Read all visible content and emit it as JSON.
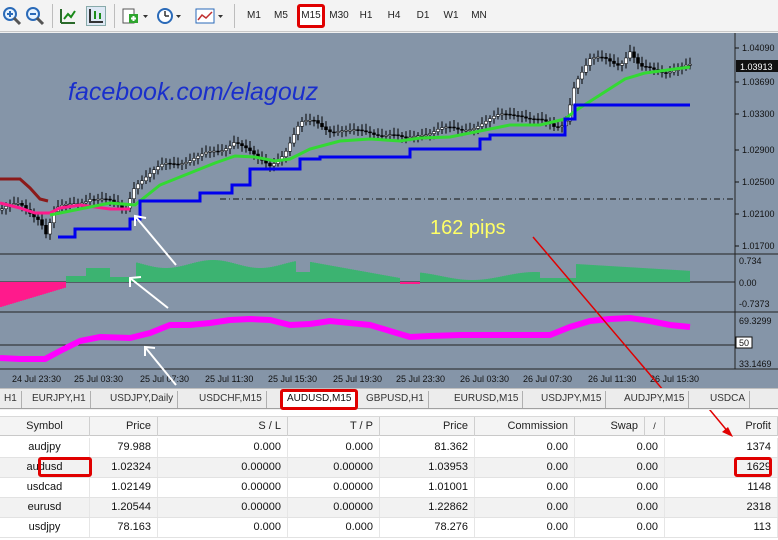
{
  "toolbar": {
    "icons": [
      "zoom-in-icon",
      "zoom-out-icon",
      "chart-type-icon",
      "crosshair-icon",
      "new-order-icon",
      "clock-icon",
      "templates-icon"
    ],
    "timeframes": [
      "M1",
      "M5",
      "M15",
      "M30",
      "H1",
      "H4",
      "D1",
      "W1",
      "MN"
    ],
    "selected_timeframe": "M15"
  },
  "chart": {
    "watermark": "facebook.com/elagouz",
    "annotation": "162 pips",
    "price_labels": [
      "1.04090",
      "1.03913",
      "1.03690",
      "1.03300",
      "1.02900",
      "1.02500",
      "1.02100",
      "1.01700"
    ],
    "current_price": "1.03913",
    "osc1_labels": [
      "0.734",
      "0.00",
      "-0.7373"
    ],
    "osc2_labels": [
      "69.3299",
      "50",
      "33.1469"
    ],
    "time_labels": [
      "24 Jul 23:30",
      "25 Jul 03:30",
      "25 Jul 07:30",
      "25 Jul 11:30",
      "25 Jul 15:30",
      "25 Jul 19:30",
      "25 Jul 23:30",
      "26 Jul 03:30",
      "26 Jul 07:30",
      "26 Jul 11:30",
      "26 Jul 15:30"
    ],
    "colors": {
      "background": "#8595a8",
      "blue_line": "#0000ee",
      "green_line": "#33d933",
      "pink_line": "#ff1a8c",
      "brown_line": "#8b1a1a",
      "histogram": "#3cb371",
      "rsi": "#ff00ff",
      "annotation": "#ffff66",
      "arrow": "#e00000"
    }
  },
  "tabs": [
    {
      "label": "H1"
    },
    {
      "label": "EURJPY,H1"
    },
    {
      "label": "USDJPY,Daily"
    },
    {
      "label": "USDCHF,M15"
    },
    {
      "label": "AUDUSD,M15",
      "active": true
    },
    {
      "label": "GBPUSD,H1"
    },
    {
      "label": "EURUSD,M15"
    },
    {
      "label": "USDJPY,M15"
    },
    {
      "label": "AUDJPY,M15"
    },
    {
      "label": "USDCA"
    }
  ],
  "table": {
    "headers": [
      "Symbol",
      "Price",
      "S / L",
      "T / P",
      "Price",
      "Commission",
      "Swap",
      "/",
      "Profit"
    ],
    "rows": [
      {
        "symbol": "audjpy",
        "price": "79.988",
        "sl": "0.000",
        "tp": "0.000",
        "price2": "81.362",
        "commission": "0.00",
        "swap": "0.00",
        "profit": "1374"
      },
      {
        "symbol": "audusd",
        "price": "1.02324",
        "sl": "0.00000",
        "tp": "0.00000",
        "price2": "1.03953",
        "commission": "0.00",
        "swap": "0.00",
        "profit": "1629"
      },
      {
        "symbol": "usdcad",
        "price": "1.02149",
        "sl": "0.00000",
        "tp": "0.00000",
        "price2": "1.01001",
        "commission": "0.00",
        "swap": "0.00",
        "profit": "1148"
      },
      {
        "symbol": "eurusd",
        "price": "1.20544",
        "sl": "0.00000",
        "tp": "0.00000",
        "price2": "1.22862",
        "commission": "0.00",
        "swap": "0.00",
        "profit": "2318"
      },
      {
        "symbol": "usdjpy",
        "price": "78.163",
        "sl": "0.000",
        "tp": "0.000",
        "price2": "78.276",
        "commission": "0.00",
        "swap": "0.00",
        "profit": "113"
      }
    ]
  }
}
